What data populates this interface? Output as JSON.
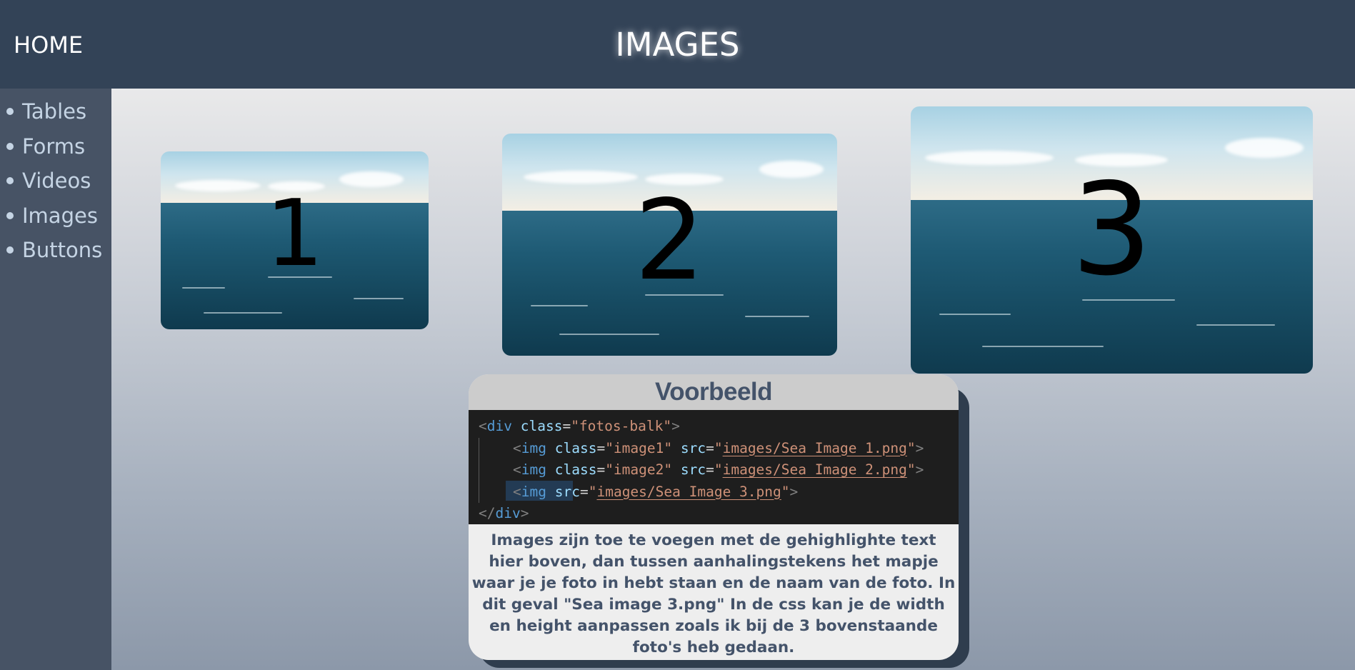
{
  "header": {
    "home_label": "HOME",
    "title": "IMAGES"
  },
  "sidebar": {
    "items": [
      {
        "label": "Tables"
      },
      {
        "label": "Forms"
      },
      {
        "label": "Videos"
      },
      {
        "label": "Images"
      },
      {
        "label": "Buttons"
      }
    ]
  },
  "images": [
    {
      "number": "1",
      "alt": "Sea Image 1"
    },
    {
      "number": "2",
      "alt": "Sea Image 2"
    },
    {
      "number": "3",
      "alt": "Sea Image 3"
    }
  ],
  "example": {
    "title": "Voorbeeld",
    "code": {
      "line1": {
        "open": "<",
        "tag": "div",
        "attr": "class",
        "eq": "=",
        "val": "\"fotos-balk\"",
        "close": ">"
      },
      "line2": {
        "open": "<",
        "tag": "img",
        "attr1": "class",
        "eq": "=",
        "val1": "\"image1\"",
        "attr2": "src",
        "q1": "\"",
        "link": "images/Sea Image 1.png",
        "q2": "\"",
        "close": ">"
      },
      "line3": {
        "open": "<",
        "tag": "img",
        "attr1": "class",
        "eq": "=",
        "val1": "\"image2\"",
        "attr2": "src",
        "q1": "\"",
        "link": "images/Sea Image 2.png",
        "q2": "\"",
        "close": ">"
      },
      "line4": {
        "open": "<",
        "tag": "img",
        "attr2": "src",
        "eq": "=",
        "q1": "\"",
        "link": "images/Sea Image 3.png",
        "q2": "\"",
        "close": ">"
      },
      "line5": {
        "open": "</",
        "tag": "div",
        "close": ">"
      }
    },
    "description": "Images zijn toe te voegen met de gehighlighte text hier boven, dan tussen aanhalingstekens het mapje waar je je foto in hebt staan en de naam van de foto. In dit geval \"Sea image 3.png\" In de css kan je de width en height aanpassen zoals ik bij de 3 bovenstaande foto's heb gedaan."
  },
  "colors": {
    "topbar": "#334357",
    "sidebar": "#475365",
    "sidebar_text": "#c5d4e4",
    "card_title_text": "#44536a",
    "code_bg": "#1e1e1e"
  }
}
